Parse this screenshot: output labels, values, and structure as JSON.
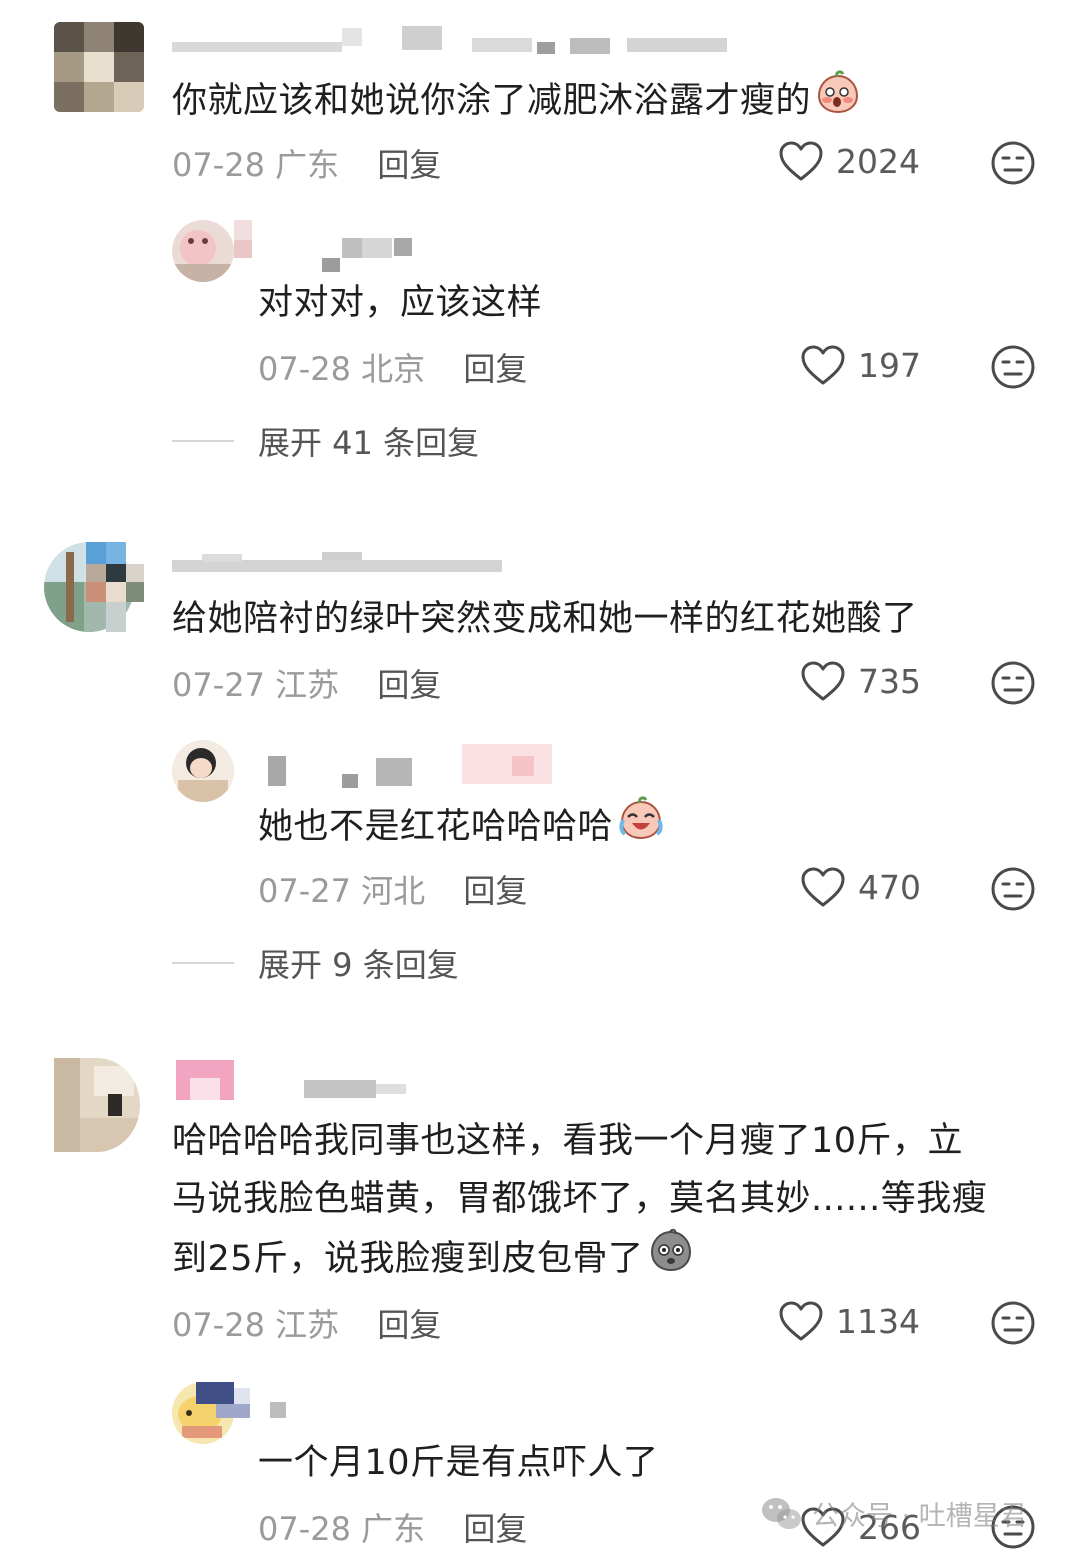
{
  "comments": [
    {
      "text": "你就应该和她说你涂了减肥沐浴露才瘦的",
      "emoji": "shy-peach-emoji",
      "date": "07-28",
      "location": "广东",
      "reply_label": "回复",
      "likes": "2024"
    },
    {
      "text": "对对对，应该这样",
      "date": "07-28",
      "location": "北京",
      "reply_label": "回复",
      "likes": "197"
    },
    {
      "text": "给她陪衬的绿叶突然变成和她一样的红花她酸了",
      "date": "07-27",
      "location": "江苏",
      "reply_label": "回复",
      "likes": "735"
    },
    {
      "text": "她也不是红花哈哈哈哈",
      "emoji": "crying-laughing-peach-emoji",
      "date": "07-27",
      "location": "河北",
      "reply_label": "回复",
      "likes": "470"
    },
    {
      "text_lines": [
        "哈哈哈哈我同事也这样，看我一个月瘦了10斤，立",
        "马说我脸色蜡黄，胃都饿坏了，莫名其妙......等我瘦",
        "到25斤，说我脸瘦到皮包骨了"
      ],
      "emoji": "gray-shocked-face-emoji",
      "date": "07-28",
      "location": "江苏",
      "reply_label": "回复",
      "likes": "1134"
    },
    {
      "text": "一个月10斤是有点吓人了",
      "date": "07-28",
      "location": "广东",
      "reply_label": "回复",
      "likes": "266"
    }
  ],
  "expand_threads": [
    {
      "label": "展开 41 条回复"
    },
    {
      "label": "展开 9 条回复"
    }
  ],
  "watermark": {
    "text": "公众号 · 吐槽星君",
    "icon": "wechat-icon"
  },
  "colors": {
    "text": "#1f1f1f",
    "meta": "#9a9a9a",
    "reply": "#555555",
    "icon": "#4a4a4a"
  }
}
